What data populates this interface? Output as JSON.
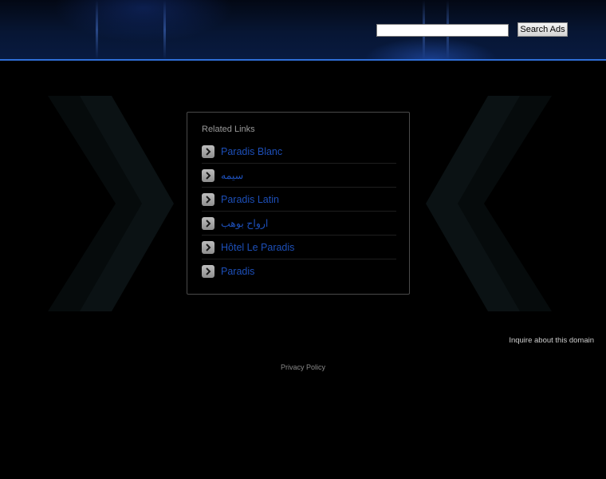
{
  "search": {
    "value": "",
    "placeholder": "",
    "button_label": "Search Ads"
  },
  "related_links": {
    "title": "Related Links",
    "items": [
      {
        "label": "Paradis Blanc"
      },
      {
        "label": "سيمه"
      },
      {
        "label": "Paradis Latin"
      },
      {
        "label": "ارواح بوهب"
      },
      {
        "label": "Hôtel Le Paradis"
      },
      {
        "label": "Paradis"
      }
    ]
  },
  "footer": {
    "inquire_label": "Inquire about this domain",
    "privacy_label": "Privacy Policy"
  },
  "colors": {
    "background": "#000000",
    "header_line": "#2f6fd8",
    "link": "#1d4fb8"
  },
  "icons": {
    "list_bullet": "chevron-right-icon",
    "background_decor": "chevron-icon"
  }
}
